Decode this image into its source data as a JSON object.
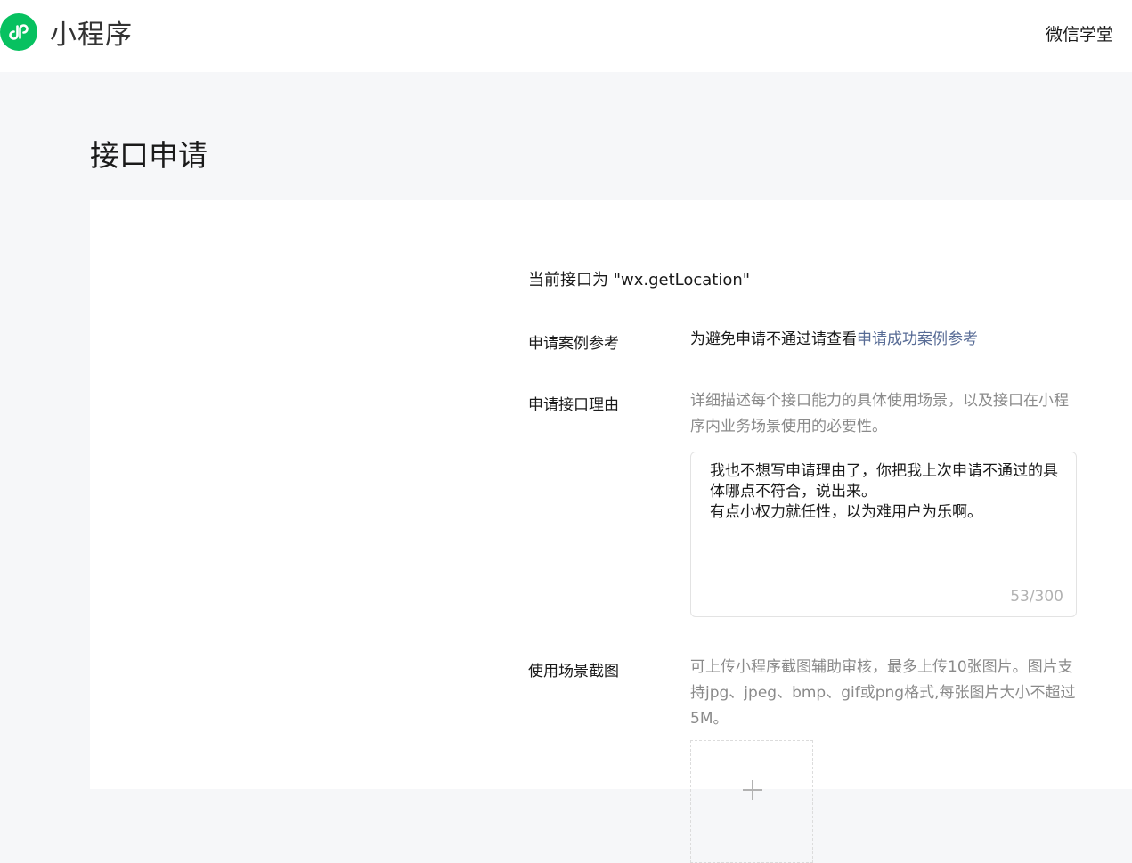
{
  "header": {
    "logo_text": "小程序",
    "nav_link": "微信学堂",
    "brand_color": "#07c160"
  },
  "page": {
    "title": "接口申请"
  },
  "form": {
    "current_api": "当前接口为 \"wx.getLocation\"",
    "case_reference": {
      "label": "申请案例参考",
      "text": "为避免申请不通过请查看",
      "link": "申请成功案例参考"
    },
    "reason": {
      "label": "申请接口理由",
      "hint": "详细描述每个接口能力的具体使用场景，以及接口在小程序内业务场景使用的必要性。",
      "value": "我也不想写申请理由了，你把我上次申请不通过的具体哪点不符合，说出来。\n有点小权力就任性，以为难用户为乐啊。",
      "counter": "53/300"
    },
    "screenshots": {
      "label": "使用场景截图",
      "hint": "可上传小程序截图辅助审核，最多上传10张图片。图片支持jpg、jpeg、bmp、gif或png格式,每张图片大小不超过5M。",
      "upload_icon": "plus-icon"
    }
  }
}
